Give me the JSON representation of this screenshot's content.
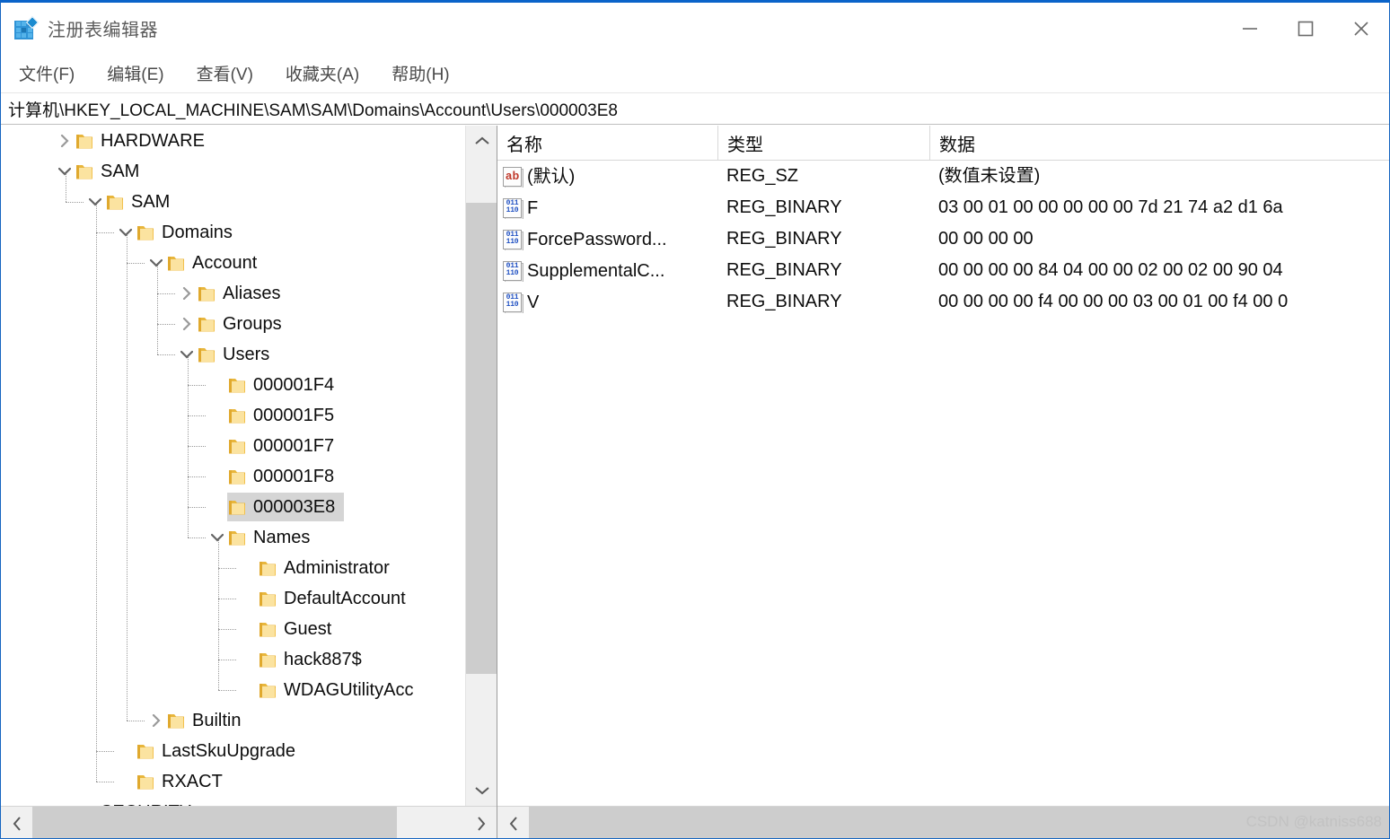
{
  "window": {
    "title": "注册表编辑器",
    "app_icon": "registry-editor-icon",
    "accent_color": "#0a63c9",
    "controls": {
      "minimize": "最小化",
      "maximize": "最大化",
      "close": "关闭"
    }
  },
  "menubar": {
    "items": [
      {
        "label": "文件(F)"
      },
      {
        "label": "编辑(E)"
      },
      {
        "label": "查看(V)"
      },
      {
        "label": "收藏夹(A)"
      },
      {
        "label": "帮助(H)"
      }
    ]
  },
  "address": {
    "path": "计算机\\HKEY_LOCAL_MACHINE\\SAM\\SAM\\Domains\\Account\\Users\\000003E8"
  },
  "tree": {
    "selected": "000003E8",
    "nodes": [
      {
        "label": "HARDWARE",
        "depth": 1,
        "state": "collapsed",
        "selected": false
      },
      {
        "label": "SAM",
        "depth": 1,
        "state": "expanded",
        "selected": false
      },
      {
        "label": "SAM",
        "depth": 2,
        "state": "expanded",
        "selected": false
      },
      {
        "label": "Domains",
        "depth": 3,
        "state": "expanded",
        "selected": false
      },
      {
        "label": "Account",
        "depth": 4,
        "state": "expanded",
        "selected": false
      },
      {
        "label": "Aliases",
        "depth": 5,
        "state": "collapsed",
        "selected": false
      },
      {
        "label": "Groups",
        "depth": 5,
        "state": "collapsed",
        "selected": false
      },
      {
        "label": "Users",
        "depth": 5,
        "state": "expanded",
        "selected": false
      },
      {
        "label": "000001F4",
        "depth": 6,
        "state": "leaf",
        "selected": false
      },
      {
        "label": "000001F5",
        "depth": 6,
        "state": "leaf",
        "selected": false
      },
      {
        "label": "000001F7",
        "depth": 6,
        "state": "leaf",
        "selected": false
      },
      {
        "label": "000001F8",
        "depth": 6,
        "state": "leaf",
        "selected": false
      },
      {
        "label": "000003E8",
        "depth": 6,
        "state": "leaf",
        "selected": true
      },
      {
        "label": "Names",
        "depth": 6,
        "state": "expanded",
        "selected": false
      },
      {
        "label": "Administrator",
        "depth": 7,
        "state": "leaf",
        "selected": false
      },
      {
        "label": "DefaultAccount",
        "depth": 7,
        "state": "leaf",
        "selected": false
      },
      {
        "label": "Guest",
        "depth": 7,
        "state": "leaf",
        "selected": false
      },
      {
        "label": "hack887$",
        "depth": 7,
        "state": "leaf",
        "selected": false
      },
      {
        "label": "WDAGUtilityAcc",
        "depth": 7,
        "state": "leaf",
        "selected": false
      },
      {
        "label": "Builtin",
        "depth": 4,
        "state": "collapsed",
        "selected": false
      },
      {
        "label": "LastSkuUpgrade",
        "depth": 3,
        "state": "leaf",
        "selected": false
      },
      {
        "label": "RXACT",
        "depth": 3,
        "state": "leaf",
        "selected": false
      },
      {
        "label": "SECURITY",
        "depth": 1,
        "state": "leaf",
        "selected": false
      }
    ]
  },
  "values": {
    "columns": {
      "name": "名称",
      "type": "类型",
      "data": "数据"
    },
    "rows": [
      {
        "name": "(默认)",
        "icon": "string-value-icon",
        "type": "REG_SZ",
        "data": "(数值未设置)"
      },
      {
        "name": "F",
        "icon": "binary-value-icon",
        "type": "REG_BINARY",
        "data": "03 00 01 00 00 00 00 00 7d 21 74 a2 d1 6a"
      },
      {
        "name": "ForcePassword...",
        "icon": "binary-value-icon",
        "type": "REG_BINARY",
        "data": "00 00 00 00"
      },
      {
        "name": "SupplementalC...",
        "icon": "binary-value-icon",
        "type": "REG_BINARY",
        "data": "00 00 00 00 84 04 00 00 02 00 02 00 90 04"
      },
      {
        "name": "V",
        "icon": "binary-value-icon",
        "type": "REG_BINARY",
        "data": "00 00 00 00 f4 00 00 00 03 00 01 00 f4 00 0"
      }
    ]
  },
  "watermark": {
    "text": "CSDN @katniss688"
  }
}
